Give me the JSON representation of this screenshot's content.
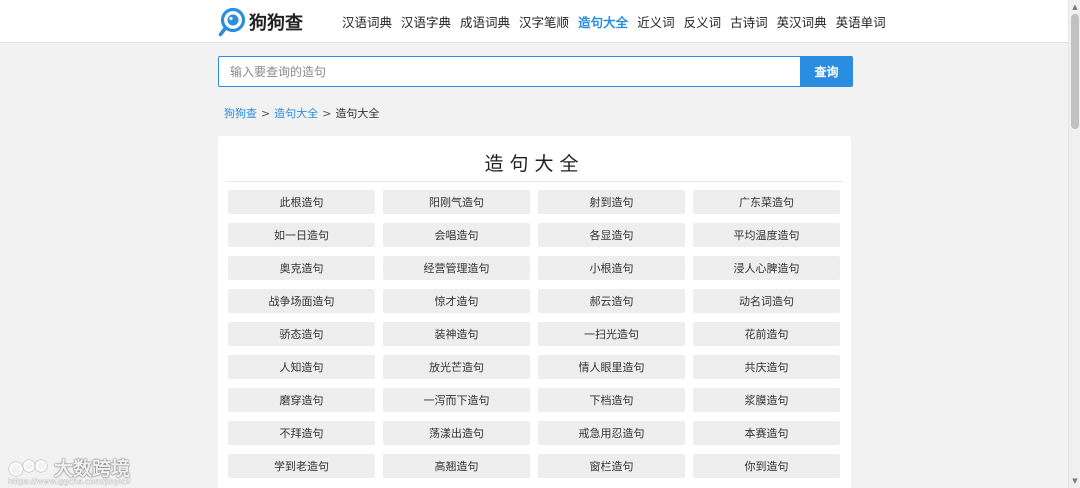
{
  "header": {
    "logo_text": "狗狗查",
    "nav": [
      {
        "label": "汉语词典",
        "active": false
      },
      {
        "label": "汉语字典",
        "active": false
      },
      {
        "label": "成语词典",
        "active": false
      },
      {
        "label": "汉字笔顺",
        "active": false
      },
      {
        "label": "造句大全",
        "active": true
      },
      {
        "label": "近义词",
        "active": false
      },
      {
        "label": "反义词",
        "active": false
      },
      {
        "label": "古诗词",
        "active": false
      },
      {
        "label": "英汉词典",
        "active": false
      },
      {
        "label": "英语单词",
        "active": false
      }
    ]
  },
  "search": {
    "placeholder": "输入要查询的造句",
    "button_label": "查询"
  },
  "breadcrumb": {
    "home": "狗狗查",
    "sep1": ">",
    "section": "造句大全",
    "sep2": ">",
    "current": "造句大全"
  },
  "main": {
    "title": "造句大全",
    "items": [
      "此根造句",
      "阳刚气造句",
      "射到造句",
      "广东菜造句",
      "如一日造句",
      "会唱造句",
      "各显造句",
      "平均温度造句",
      "奥克造句",
      "经营管理造句",
      "小根造句",
      "浸人心脾造句",
      "战争场面造句",
      "惊才造句",
      "郝云造句",
      "动名词造句",
      "骄态造句",
      "装神造句",
      "一扫光造句",
      "花前造句",
      "人知造句",
      "放光芒造句",
      "情人眼里造句",
      "共庆造句",
      "磨穿造句",
      "一泻而下造句",
      "下档造句",
      "浆膜造句",
      "不拜造句",
      "荡漾出造句",
      "戒急用忍造句",
      "本赛造句",
      "学到老造句",
      "高翘造句",
      "窗栏造句",
      "你到造句"
    ]
  },
  "watermark": {
    "text": "大数跨境",
    "url": "https://www.ggcha.com/jinyici/"
  },
  "colors": {
    "accent": "#2a8de0",
    "cell_bg": "#eeeeee",
    "page_bg": "#f2f2f2"
  },
  "icons": {
    "logo": "magnifier-dog-logo-icon",
    "scroll_up": "chevron-up-icon",
    "scroll_down": "chevron-down-icon"
  }
}
